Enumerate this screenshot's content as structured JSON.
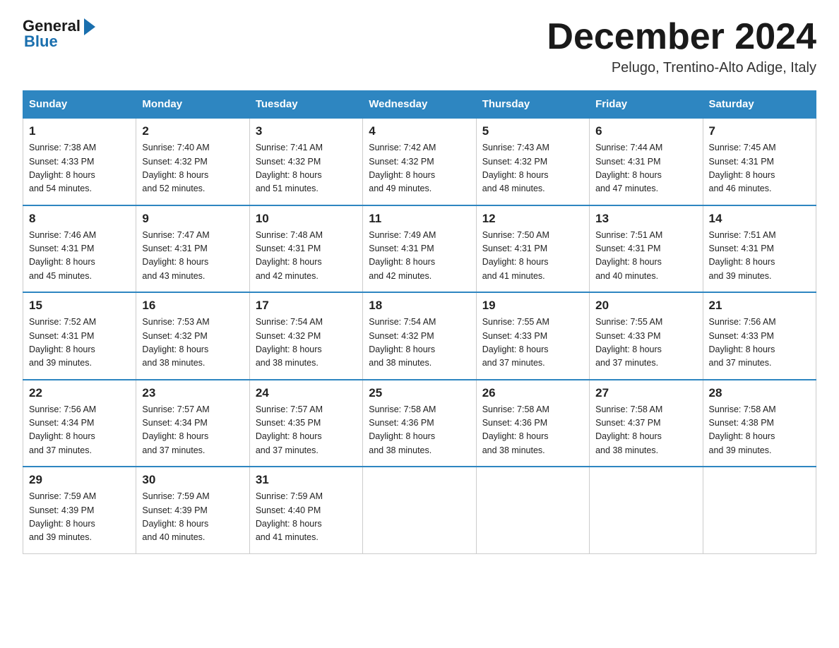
{
  "logo": {
    "general": "General",
    "blue": "Blue"
  },
  "title": "December 2024",
  "subtitle": "Pelugo, Trentino-Alto Adige, Italy",
  "days_of_week": [
    "Sunday",
    "Monday",
    "Tuesday",
    "Wednesday",
    "Thursday",
    "Friday",
    "Saturday"
  ],
  "weeks": [
    [
      {
        "day": "1",
        "sunrise": "Sunrise: 7:38 AM",
        "sunset": "Sunset: 4:33 PM",
        "daylight": "Daylight: 8 hours",
        "daylight2": "and 54 minutes."
      },
      {
        "day": "2",
        "sunrise": "Sunrise: 7:40 AM",
        "sunset": "Sunset: 4:32 PM",
        "daylight": "Daylight: 8 hours",
        "daylight2": "and 52 minutes."
      },
      {
        "day": "3",
        "sunrise": "Sunrise: 7:41 AM",
        "sunset": "Sunset: 4:32 PM",
        "daylight": "Daylight: 8 hours",
        "daylight2": "and 51 minutes."
      },
      {
        "day": "4",
        "sunrise": "Sunrise: 7:42 AM",
        "sunset": "Sunset: 4:32 PM",
        "daylight": "Daylight: 8 hours",
        "daylight2": "and 49 minutes."
      },
      {
        "day": "5",
        "sunrise": "Sunrise: 7:43 AM",
        "sunset": "Sunset: 4:32 PM",
        "daylight": "Daylight: 8 hours",
        "daylight2": "and 48 minutes."
      },
      {
        "day": "6",
        "sunrise": "Sunrise: 7:44 AM",
        "sunset": "Sunset: 4:31 PM",
        "daylight": "Daylight: 8 hours",
        "daylight2": "and 47 minutes."
      },
      {
        "day": "7",
        "sunrise": "Sunrise: 7:45 AM",
        "sunset": "Sunset: 4:31 PM",
        "daylight": "Daylight: 8 hours",
        "daylight2": "and 46 minutes."
      }
    ],
    [
      {
        "day": "8",
        "sunrise": "Sunrise: 7:46 AM",
        "sunset": "Sunset: 4:31 PM",
        "daylight": "Daylight: 8 hours",
        "daylight2": "and 45 minutes."
      },
      {
        "day": "9",
        "sunrise": "Sunrise: 7:47 AM",
        "sunset": "Sunset: 4:31 PM",
        "daylight": "Daylight: 8 hours",
        "daylight2": "and 43 minutes."
      },
      {
        "day": "10",
        "sunrise": "Sunrise: 7:48 AM",
        "sunset": "Sunset: 4:31 PM",
        "daylight": "Daylight: 8 hours",
        "daylight2": "and 42 minutes."
      },
      {
        "day": "11",
        "sunrise": "Sunrise: 7:49 AM",
        "sunset": "Sunset: 4:31 PM",
        "daylight": "Daylight: 8 hours",
        "daylight2": "and 42 minutes."
      },
      {
        "day": "12",
        "sunrise": "Sunrise: 7:50 AM",
        "sunset": "Sunset: 4:31 PM",
        "daylight": "Daylight: 8 hours",
        "daylight2": "and 41 minutes."
      },
      {
        "day": "13",
        "sunrise": "Sunrise: 7:51 AM",
        "sunset": "Sunset: 4:31 PM",
        "daylight": "Daylight: 8 hours",
        "daylight2": "and 40 minutes."
      },
      {
        "day": "14",
        "sunrise": "Sunrise: 7:51 AM",
        "sunset": "Sunset: 4:31 PM",
        "daylight": "Daylight: 8 hours",
        "daylight2": "and 39 minutes."
      }
    ],
    [
      {
        "day": "15",
        "sunrise": "Sunrise: 7:52 AM",
        "sunset": "Sunset: 4:31 PM",
        "daylight": "Daylight: 8 hours",
        "daylight2": "and 39 minutes."
      },
      {
        "day": "16",
        "sunrise": "Sunrise: 7:53 AM",
        "sunset": "Sunset: 4:32 PM",
        "daylight": "Daylight: 8 hours",
        "daylight2": "and 38 minutes."
      },
      {
        "day": "17",
        "sunrise": "Sunrise: 7:54 AM",
        "sunset": "Sunset: 4:32 PM",
        "daylight": "Daylight: 8 hours",
        "daylight2": "and 38 minutes."
      },
      {
        "day": "18",
        "sunrise": "Sunrise: 7:54 AM",
        "sunset": "Sunset: 4:32 PM",
        "daylight": "Daylight: 8 hours",
        "daylight2": "and 38 minutes."
      },
      {
        "day": "19",
        "sunrise": "Sunrise: 7:55 AM",
        "sunset": "Sunset: 4:33 PM",
        "daylight": "Daylight: 8 hours",
        "daylight2": "and 37 minutes."
      },
      {
        "day": "20",
        "sunrise": "Sunrise: 7:55 AM",
        "sunset": "Sunset: 4:33 PM",
        "daylight": "Daylight: 8 hours",
        "daylight2": "and 37 minutes."
      },
      {
        "day": "21",
        "sunrise": "Sunrise: 7:56 AM",
        "sunset": "Sunset: 4:33 PM",
        "daylight": "Daylight: 8 hours",
        "daylight2": "and 37 minutes."
      }
    ],
    [
      {
        "day": "22",
        "sunrise": "Sunrise: 7:56 AM",
        "sunset": "Sunset: 4:34 PM",
        "daylight": "Daylight: 8 hours",
        "daylight2": "and 37 minutes."
      },
      {
        "day": "23",
        "sunrise": "Sunrise: 7:57 AM",
        "sunset": "Sunset: 4:34 PM",
        "daylight": "Daylight: 8 hours",
        "daylight2": "and 37 minutes."
      },
      {
        "day": "24",
        "sunrise": "Sunrise: 7:57 AM",
        "sunset": "Sunset: 4:35 PM",
        "daylight": "Daylight: 8 hours",
        "daylight2": "and 37 minutes."
      },
      {
        "day": "25",
        "sunrise": "Sunrise: 7:58 AM",
        "sunset": "Sunset: 4:36 PM",
        "daylight": "Daylight: 8 hours",
        "daylight2": "and 38 minutes."
      },
      {
        "day": "26",
        "sunrise": "Sunrise: 7:58 AM",
        "sunset": "Sunset: 4:36 PM",
        "daylight": "Daylight: 8 hours",
        "daylight2": "and 38 minutes."
      },
      {
        "day": "27",
        "sunrise": "Sunrise: 7:58 AM",
        "sunset": "Sunset: 4:37 PM",
        "daylight": "Daylight: 8 hours",
        "daylight2": "and 38 minutes."
      },
      {
        "day": "28",
        "sunrise": "Sunrise: 7:58 AM",
        "sunset": "Sunset: 4:38 PM",
        "daylight": "Daylight: 8 hours",
        "daylight2": "and 39 minutes."
      }
    ],
    [
      {
        "day": "29",
        "sunrise": "Sunrise: 7:59 AM",
        "sunset": "Sunset: 4:39 PM",
        "daylight": "Daylight: 8 hours",
        "daylight2": "and 39 minutes."
      },
      {
        "day": "30",
        "sunrise": "Sunrise: 7:59 AM",
        "sunset": "Sunset: 4:39 PM",
        "daylight": "Daylight: 8 hours",
        "daylight2": "and 40 minutes."
      },
      {
        "day": "31",
        "sunrise": "Sunrise: 7:59 AM",
        "sunset": "Sunset: 4:40 PM",
        "daylight": "Daylight: 8 hours",
        "daylight2": "and 41 minutes."
      },
      null,
      null,
      null,
      null
    ]
  ]
}
